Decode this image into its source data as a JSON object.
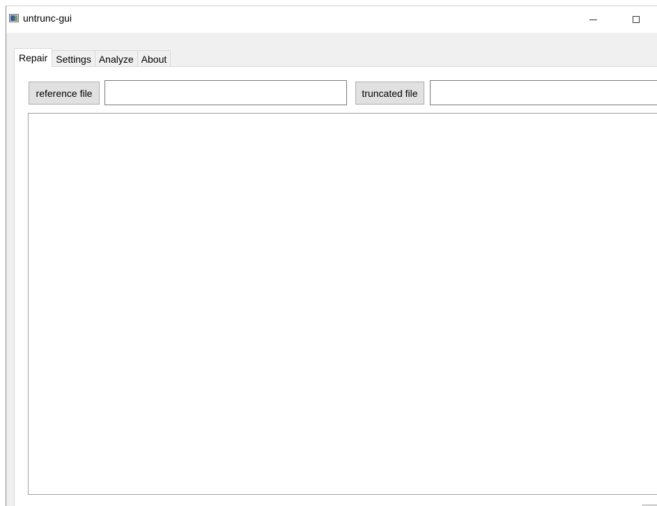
{
  "window": {
    "title": "untrunc-gui",
    "icon": "app-icon",
    "controls": {
      "minimize_icon": "minimize-icon",
      "maximize_icon": "maximize-icon"
    }
  },
  "tabs": [
    {
      "label": "Repair",
      "active": true
    },
    {
      "label": "Settings",
      "active": false
    },
    {
      "label": "Analyze",
      "active": false
    },
    {
      "label": "About",
      "active": false
    }
  ],
  "repair": {
    "reference_button_label": "reference file",
    "reference_value": "",
    "truncated_button_label": "truncated file",
    "truncated_value": "",
    "log_text": ""
  },
  "colors": {
    "window_bg": "#f0f0f0",
    "titlebar_bg": "#ffffff",
    "button_bg": "#e1e1e1",
    "button_border": "#adadad"
  }
}
